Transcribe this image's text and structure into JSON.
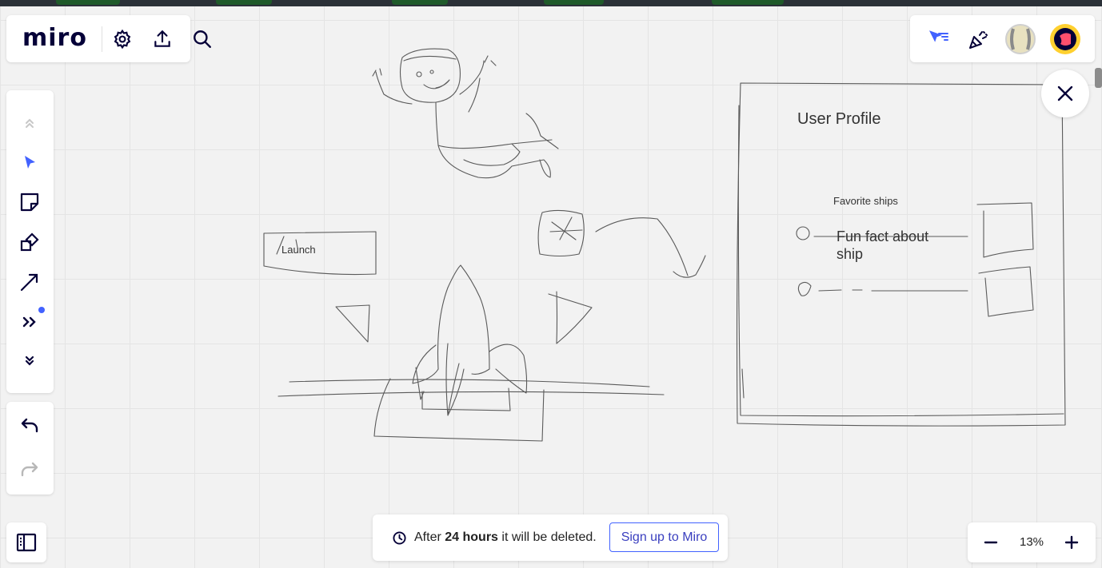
{
  "app": {
    "logo": "miro"
  },
  "top_right": {
    "icons": [
      "cursor-filter-icon",
      "party-popper-icon",
      "avatar-icon",
      "user-avatar-icon"
    ]
  },
  "toolbar": {
    "tools": [
      "collapse-up-icon",
      "select-icon",
      "sticky-note-icon",
      "shapes-icon",
      "arrow-line-icon",
      "more-tools-icon",
      "expand-down-icon"
    ],
    "accent": "#4262ff"
  },
  "canvas": {
    "launch_label": "Launch",
    "profile_title": "User Profile",
    "favorite_ships": "Favorite ships",
    "fun_fact": "Fun fact about ship"
  },
  "toast": {
    "prefix": "After",
    "bold": "24 hours",
    "suffix": "it will be deleted.",
    "signup": "Sign up to Miro"
  },
  "zoom": {
    "value": "13%"
  }
}
